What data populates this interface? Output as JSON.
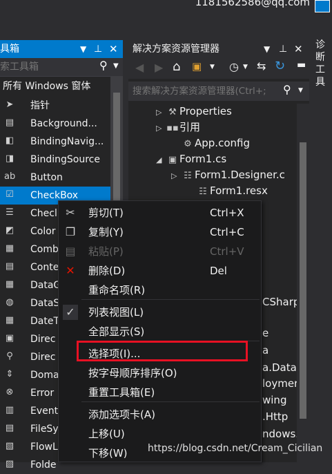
{
  "account": {
    "email": "1181562586@qq.com"
  },
  "toolbox": {
    "title": "具箱",
    "search_placeholder": "索工具箱",
    "category": "所有 Windows 窗体",
    "items": [
      {
        "label": "指针",
        "icon": "pointer-icon"
      },
      {
        "label": "Background...",
        "icon": "background-worker-icon"
      },
      {
        "label": "BindingNavig...",
        "icon": "binding-navigator-icon"
      },
      {
        "label": "BindingSource",
        "icon": "binding-source-icon"
      },
      {
        "label": "Button",
        "icon": "button-icon"
      },
      {
        "label": "CheckBox",
        "icon": "checkbox-icon"
      },
      {
        "label": "Checl",
        "icon": "checked-listbox-icon"
      },
      {
        "label": "Color",
        "icon": "color-dialog-icon"
      },
      {
        "label": "Comb",
        "icon": "combobox-icon"
      },
      {
        "label": "Conte",
        "icon": "context-menu-icon"
      },
      {
        "label": "DataG",
        "icon": "datagrid-icon"
      },
      {
        "label": "DataS",
        "icon": "dataset-icon"
      },
      {
        "label": "DateT",
        "icon": "datetime-icon"
      },
      {
        "label": "Direc",
        "icon": "directory-entry-icon"
      },
      {
        "label": "Direc",
        "icon": "directory-searcher-icon"
      },
      {
        "label": "Doma",
        "icon": "domain-updown-icon"
      },
      {
        "label": "Error",
        "icon": "error-provider-icon"
      },
      {
        "label": "Event",
        "icon": "eventlog-icon"
      },
      {
        "label": "FileSy",
        "icon": "filesystem-watcher-icon"
      },
      {
        "label": "FlowL",
        "icon": "flow-layout-icon"
      },
      {
        "label": "Folde",
        "icon": "folder-browser-icon"
      }
    ],
    "selected_index": 5
  },
  "solution_explorer": {
    "title": "解决方案资源管理器",
    "search_placeholder": "搜索解决方案资源管理器(Ctrl+;",
    "tree": [
      {
        "label": "Properties",
        "icon": "wrench-icon",
        "expander": "▷"
      },
      {
        "label": "引用",
        "icon": "references-icon",
        "expander": "▷"
      },
      {
        "label": "App.config",
        "icon": "config-file-icon",
        "expander": ""
      },
      {
        "label": "Form1.cs",
        "icon": "form-icon",
        "expander": "◢"
      },
      {
        "label": "Form1.Designer.c",
        "icon": "csharp-file-icon",
        "expander": "▷"
      },
      {
        "label": "Form1.resx",
        "icon": "resx-file-icon",
        "expander": ""
      }
    ],
    "partial_texts": [
      "CSharp",
      "e",
      "a",
      "a.DataS",
      "loymer",
      "wing",
      ".Http",
      "ndows."
    ]
  },
  "side_tab": {
    "label": "诊断工具"
  },
  "context_menu": {
    "items": [
      {
        "label": "剪切(T)",
        "shortcut": "Ctrl+X",
        "icon": "scissors-icon",
        "disabled": false
      },
      {
        "label": "复制(Y)",
        "shortcut": "Ctrl+C",
        "icon": "copy-icon",
        "disabled": false
      },
      {
        "label": "粘贴(P)",
        "shortcut": "Ctrl+V",
        "icon": "paste-icon",
        "disabled": true
      },
      {
        "label": "删除(D)",
        "shortcut": "Del",
        "icon": "delete-x-icon",
        "disabled": false
      },
      {
        "label": "重命名项(R)",
        "shortcut": "",
        "icon": "",
        "disabled": false
      },
      {
        "label": "列表视图(L)",
        "shortcut": "",
        "icon": "checkmark-icon",
        "disabled": false
      },
      {
        "label": "全部显示(S)",
        "shortcut": "",
        "icon": "",
        "disabled": false
      },
      {
        "label": "选择项(I)...",
        "shortcut": "",
        "icon": "",
        "disabled": false
      },
      {
        "label": "按字母顺序排序(O)",
        "shortcut": "",
        "icon": "",
        "disabled": false
      },
      {
        "label": "重置工具箱(E)",
        "shortcut": "",
        "icon": "",
        "disabled": false
      },
      {
        "label": "添加选项卡(A)",
        "shortcut": "",
        "icon": "",
        "disabled": false
      },
      {
        "label": "上移(U)",
        "shortcut": "",
        "icon": "",
        "disabled": false
      },
      {
        "label": "下移(W)",
        "shortcut": "",
        "icon": "",
        "disabled": false
      }
    ]
  },
  "watermark": "https://blog.csdn.net/Cream_Cicilian",
  "colors": {
    "accent": "#007acc",
    "highlight": "#e81123",
    "background": "#2d2d30",
    "panel": "#252526"
  }
}
